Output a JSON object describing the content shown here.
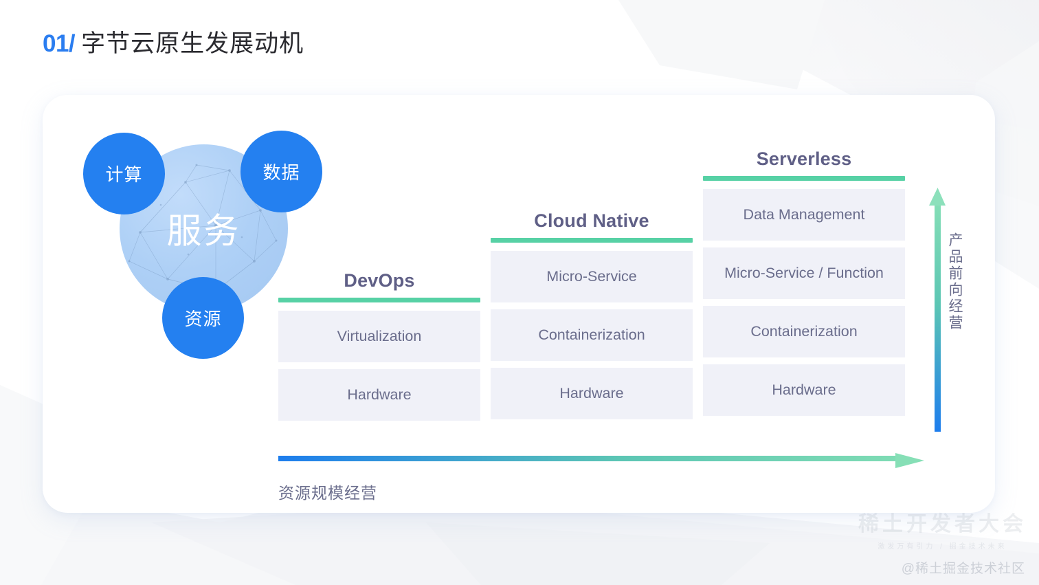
{
  "slide": {
    "number": "01/",
    "title": "字节云原生发展动机"
  },
  "venn": {
    "center_label": "服务",
    "bubbles": [
      {
        "label": "计算",
        "name": "compute"
      },
      {
        "label": "数据",
        "name": "data"
      },
      {
        "label": "资源",
        "name": "resource"
      }
    ]
  },
  "columns": [
    {
      "title": "DevOps",
      "layers": [
        "Virtualization",
        "Hardware"
      ]
    },
    {
      "title": "Cloud Native",
      "layers": [
        "Micro-Service",
        "Containerization",
        "Hardware"
      ]
    },
    {
      "title": "Serverless",
      "layers": [
        "Data Management",
        "Micro-Service / Function",
        "Containerization",
        "Hardware"
      ]
    }
  ],
  "axes": {
    "x_label": "资源规模经营",
    "y_label": "产品前向经营"
  },
  "colors": {
    "accent_blue": "#2480f0",
    "accent_green": "#57d1a5",
    "box_bg": "#f0f1f8",
    "box_text": "#6a6d8c",
    "title_text": "#5f5f86",
    "sphere_blue": "#aed0f6"
  },
  "watermark": {
    "logo_main": "稀土开发者大会",
    "logo_sub": "激发万有引力 / 掘金技术未来",
    "handle": "@稀土掘金技术社区"
  }
}
